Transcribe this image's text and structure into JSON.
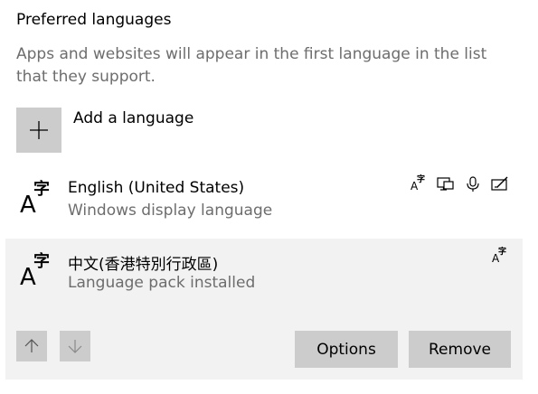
{
  "header": {
    "title": "Preferred languages",
    "description": "Apps and websites will appear in the first language in the list that they support."
  },
  "add_language": {
    "label": "Add a language",
    "icon": "plus-icon"
  },
  "languages": [
    {
      "name": "English (United States)",
      "status": "Windows display language",
      "feature_icons": [
        "text-icon",
        "display-icon",
        "microphone-icon",
        "handwriting-icon"
      ]
    },
    {
      "name": "中文(香港特別行政區)",
      "status": "Language pack installed",
      "feature_icons": [
        "text-icon"
      ],
      "selected": true
    }
  ],
  "glyph": {
    "latin": "A",
    "cjk": "字"
  },
  "actions": {
    "move_up_icon": "arrow-up-icon",
    "move_down_icon": "arrow-down-icon",
    "options_label": "Options",
    "remove_label": "Remove"
  },
  "colors": {
    "tile": "#cccccc",
    "selected_bg": "#f2f2f2",
    "secondary_text": "#6d6d6d"
  }
}
